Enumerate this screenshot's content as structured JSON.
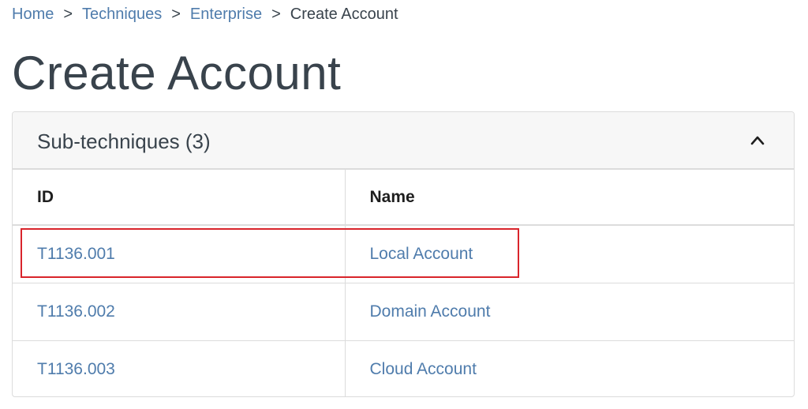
{
  "breadcrumb": {
    "items": [
      {
        "label": "Home"
      },
      {
        "label": "Techniques"
      },
      {
        "label": "Enterprise"
      }
    ],
    "separator": ">",
    "current": "Create Account"
  },
  "page": {
    "title": "Create Account"
  },
  "subtechniques": {
    "header": "Sub-techniques (3)",
    "columns": [
      "ID",
      "Name"
    ],
    "rows": [
      {
        "id": "T1136.001",
        "name": "Local Account"
      },
      {
        "id": "T1136.002",
        "name": "Domain Account"
      },
      {
        "id": "T1136.003",
        "name": "Cloud Account"
      }
    ]
  },
  "colors": {
    "link": "#4f7cac",
    "text": "#39434c",
    "highlight": "#d9242b",
    "border": "#dcdcdc"
  },
  "icons": {
    "collapse": "chevron-up-icon"
  }
}
